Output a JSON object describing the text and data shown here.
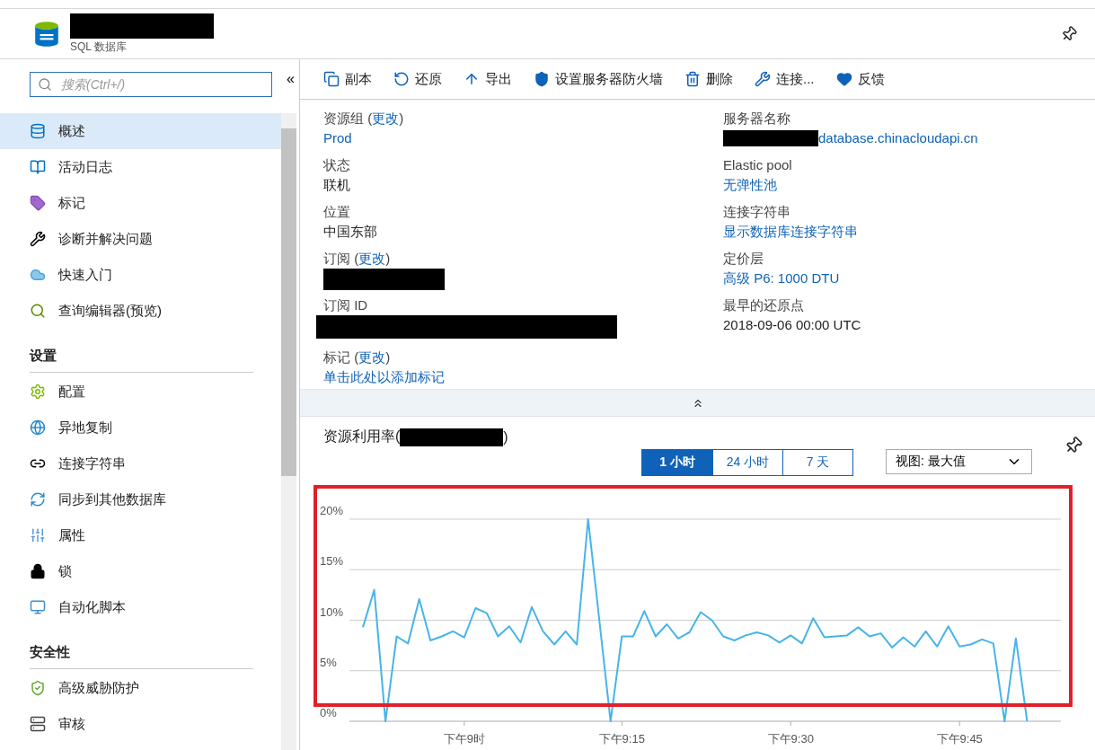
{
  "header": {
    "subtitle": "SQL 数据库"
  },
  "sidebar": {
    "search": {
      "placeholder": "搜索(Ctrl+/)"
    },
    "collapse": "«",
    "sections": [
      {
        "items": [
          {
            "label": "概述",
            "selected": true
          },
          {
            "label": "活动日志",
            "selected": false
          },
          {
            "label": "标记",
            "selected": false
          },
          {
            "label": "诊断并解决问题",
            "selected": false
          },
          {
            "label": "快速入门",
            "selected": false
          },
          {
            "label": "查询编辑器(预览)",
            "selected": false
          }
        ]
      },
      {
        "title": "设置",
        "items": [
          {
            "label": "配置",
            "selected": false
          },
          {
            "label": "异地复制",
            "selected": false
          },
          {
            "label": "连接字符串",
            "selected": false
          },
          {
            "label": "同步到其他数据库",
            "selected": false
          },
          {
            "label": "属性",
            "selected": false
          },
          {
            "label": "锁",
            "selected": false
          },
          {
            "label": "自动化脚本",
            "selected": false
          }
        ]
      },
      {
        "title": "安全性",
        "items": [
          {
            "label": "高级威胁防护",
            "selected": false
          },
          {
            "label": "审核",
            "selected": false
          }
        ]
      }
    ]
  },
  "toolbar": [
    "副本",
    "还原",
    "导出",
    "设置服务器防火墙",
    "删除",
    "连接...",
    "反馈"
  ],
  "properties": {
    "left": [
      {
        "label": "资源组 (",
        "link": "更改",
        "label_end": ")",
        "kind": "link",
        "value": "Prod"
      },
      {
        "label": "状态",
        "kind": "text",
        "value": "联机"
      },
      {
        "label": "位置",
        "kind": "text",
        "value": "中国东部"
      },
      {
        "label": "订阅 (",
        "link": "更改",
        "label_end": ")",
        "kind": "redacted"
      },
      {
        "label": "订阅 ID",
        "kind": "redacted-wide"
      },
      {
        "label": "标记 (",
        "link": "更改",
        "label_end": ")",
        "kind": "link",
        "value": "单击此处以添加标记"
      }
    ],
    "right": [
      {
        "label": "服务器名称",
        "kind": "redacted-link",
        "value": "database.chinacloudapi.cn"
      },
      {
        "label": "Elastic pool",
        "kind": "link",
        "value": "无弹性池"
      },
      {
        "label": "连接字符串",
        "kind": "link",
        "value": "显示数据库连接字符串"
      },
      {
        "label": "定价层",
        "kind": "link",
        "value": "高级 P6: 1000 DTU"
      },
      {
        "label": "最早的还原点",
        "kind": "text",
        "value": "2018-09-06 00:00 UTC"
      }
    ]
  },
  "usage": {
    "title": "资源利用率(",
    "title_end": ")",
    "time_ranges": [
      {
        "label": "1 小时",
        "selected": true
      },
      {
        "label": "24 小时",
        "selected": false
      },
      {
        "label": "7 天",
        "selected": false
      }
    ],
    "view": "视图: 最大值",
    "highlighted": true,
    "chart_data": {
      "type": "line",
      "grid": true,
      "ylim": [
        0,
        20
      ],
      "categories": [
        null,
        null,
        null,
        null,
        null,
        null,
        null,
        null,
        null,
        "下午9时",
        null,
        null,
        null,
        null,
        null,
        null,
        null,
        null,
        null,
        null,
        null,
        null,
        null,
        "下午9:15",
        null,
        null,
        null,
        null,
        null,
        null,
        null,
        null,
        null,
        null,
        null,
        null,
        null,
        null,
        "下午9:30",
        null,
        null,
        null,
        null,
        null,
        null,
        null,
        null,
        null,
        null,
        null,
        null,
        null,
        null,
        "下午9:45",
        null,
        null,
        null,
        null,
        null,
        null
      ],
      "yticks": [
        {
          "value": 0,
          "label": "0%"
        },
        {
          "value": 5,
          "label": "5%"
        },
        {
          "value": 10,
          "label": "10%"
        },
        {
          "value": 15,
          "label": "15%"
        },
        {
          "value": 20,
          "label": "20%"
        }
      ],
      "series": [
        {
          "color": "#47b4e8",
          "values": [
            9.3,
            13.0,
            0,
            8.4,
            7.7,
            12.1,
            8.0,
            8.4,
            8.9,
            8.3,
            11.2,
            10.7,
            8.4,
            9.4,
            7.8,
            11.3,
            8.9,
            7.6,
            8.9,
            7.6,
            20.0,
            10.0,
            0,
            8.4,
            8.4,
            10.9,
            8.4,
            9.6,
            8.2,
            8.8,
            10.8,
            10.0,
            8.4,
            8.0,
            8.5,
            8.8,
            8.5,
            7.8,
            8.5,
            7.7,
            10.2,
            8.3,
            8.4,
            8.5,
            9.3,
            8.4,
            8.7,
            7.3,
            8.3,
            7.4,
            8.9,
            7.4,
            9.4,
            7.4,
            7.6,
            8.1,
            7.7,
            0,
            8.2,
            0
          ]
        }
      ]
    }
  }
}
